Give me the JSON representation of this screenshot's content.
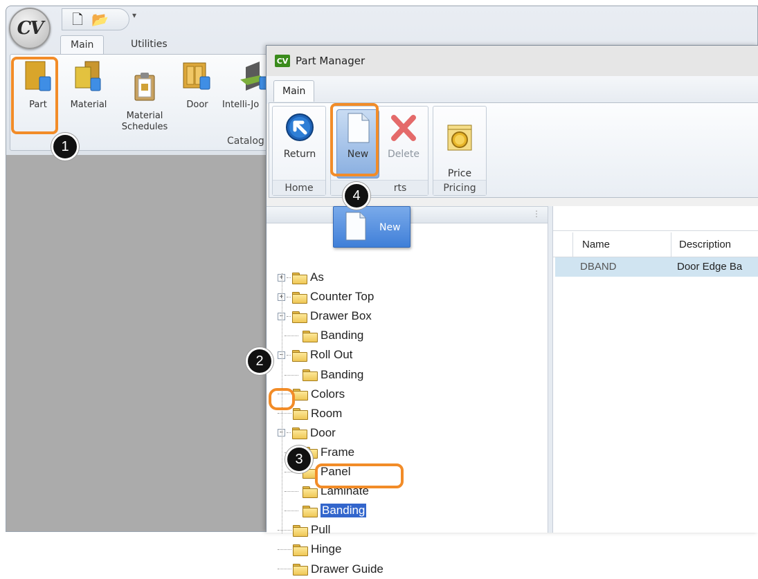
{
  "app": {
    "logo_text": "CV",
    "tabs": [
      "Main",
      "Utilities"
    ],
    "ribbon_items": [
      "Part",
      "Material",
      "Material\nSchedules",
      "Door",
      "Intelli-Jo"
    ],
    "ribbon_group_label": "Catalog"
  },
  "part_manager": {
    "logo_text": "CV",
    "title": "Part Manager",
    "tab": "Main",
    "groups": [
      {
        "label": "Home",
        "buttons": [
          "Return"
        ]
      },
      {
        "label": "rts",
        "buttons": [
          "New",
          "Delete"
        ]
      },
      {
        "label": "Pricing",
        "buttons": [
          "Price\nMatrix"
        ]
      }
    ],
    "new_popup_label": "New",
    "tree": [
      {
        "label": "As",
        "expander": "+"
      },
      {
        "label": "Counter Top",
        "expander": "+"
      },
      {
        "label": "Drawer Box",
        "expander": "-"
      },
      {
        "label": "Banding",
        "child": true
      },
      {
        "label": "Roll Out",
        "expander": "-"
      },
      {
        "label": "Banding",
        "child": true
      },
      {
        "label": "Colors"
      },
      {
        "label": "Room"
      },
      {
        "label": "Door",
        "expander": "-"
      },
      {
        "label": "Frame",
        "child": true
      },
      {
        "label": "Panel",
        "child": true
      },
      {
        "label": "Laminate",
        "child": true
      },
      {
        "label": "Banding",
        "child": true,
        "selected": true
      },
      {
        "label": "Pull"
      },
      {
        "label": "Hinge"
      },
      {
        "label": "Drawer Guide"
      }
    ],
    "grid": {
      "columns": [
        "Name",
        "Description"
      ],
      "rows": [
        [
          "DBAND",
          "Door Edge Ba"
        ]
      ]
    }
  },
  "annotations": [
    "1",
    "2",
    "3",
    "4"
  ],
  "colors": {
    "highlight": "#f28c28",
    "selection": "#3366cc",
    "row_select": "#d0e4f1"
  }
}
